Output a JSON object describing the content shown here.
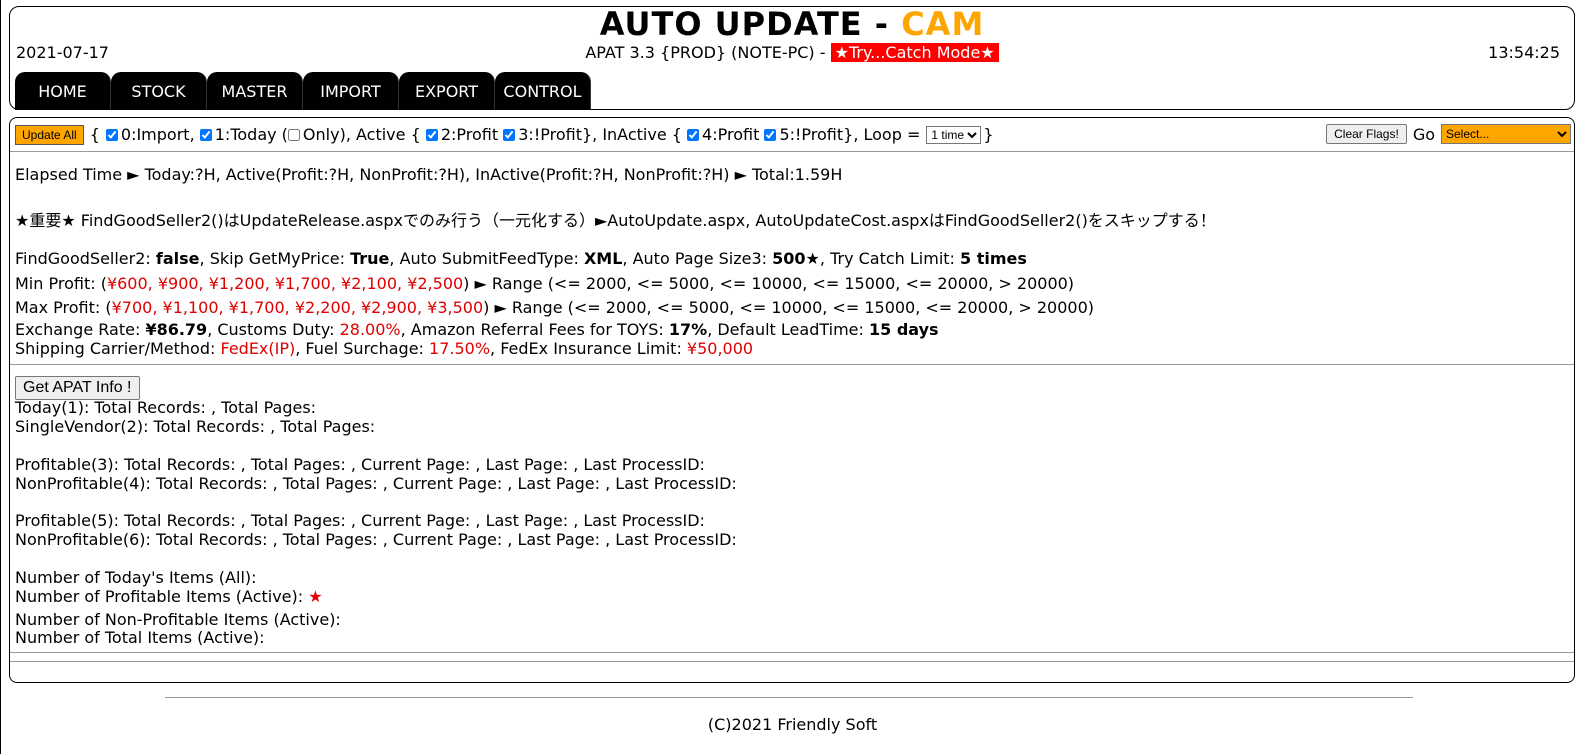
{
  "header": {
    "title_main": "AUTO UPDATE - ",
    "title_accent": "CAM",
    "date": "2021-07-17",
    "time": "13:54:25",
    "version": "APAT 3.3 {PROD} (NOTE-PC) - ",
    "mode": "★Try...Catch Mode★"
  },
  "nav": [
    "HOME",
    "STOCK",
    "MASTER",
    "IMPORT",
    "EXPORT",
    "CONTROL"
  ],
  "toolbar": {
    "update_all": "Update All",
    "open_brace": "{",
    "chk0": "0:Import,",
    "chk1": "1:Today (",
    "only": "Only), Active {",
    "chk2": "2:Profit",
    "chk3": "3:!Profit}, InActive {",
    "chk4": "4:Profit",
    "chk5": "5:!Profit}, Loop =",
    "loop_value": "1 time",
    "close_brace": "}",
    "clear_flags": "Clear Flags!",
    "go_label": "Go",
    "go_select": "Select..."
  },
  "info": {
    "elapsed": "Elapsed Time ► Today:?H, Active(Profit:?H, NonProfit:?H), InActive(Profit:?H, NonProfit:?H) ► Total:1.59H",
    "important": "★重要★ FindGoodSeller2()はUpdateRelease.aspxでのみ行う（一元化する）►AutoUpdate.aspx, AutoUpdateCost.aspxはFindGoodSeller2()をスキップする！",
    "fgs_label": "FindGoodSeller2: ",
    "fgs_value": "false",
    "skip_label": ", Skip GetMyPrice: ",
    "skip_value": "True",
    "feed_label": ", Auto SubmitFeedType: ",
    "feed_value": "XML",
    "page_label": ", Auto Page Size3: ",
    "page_value": "500★",
    "catch_label": ", Try Catch Limit: ",
    "catch_value": "5 times",
    "min_label": "Min Profit: (",
    "min_values": "¥600, ¥900, ¥1,200, ¥1,700, ¥2,100, ¥2,500",
    "min_range": ") ► Range (<= 2000, <= 5000, <= 10000, <= 15000, <= 20000, > 20000)",
    "max_label": "Max Profit: (",
    "max_values": "¥700, ¥1,100, ¥1,700, ¥2,200, ¥2,900, ¥3,500",
    "max_range": ") ► Range (<= 2000, <= 5000, <= 10000, <= 15000, <= 20000, > 20000)",
    "ex_label": "Exchange Rate: ",
    "ex_value": "¥86.79",
    "duty_label": ", Customs Duty: ",
    "duty_value": "28.00%",
    "fee_label": ", Amazon Referral Fees for TOYS: ",
    "fee_value": "17%",
    "lead_label": ", Default LeadTime: ",
    "lead_value": "15 days",
    "ship_label": "Shipping Carrier/Method: ",
    "ship_value": "FedEx(IP)",
    "fuel_label": ", Fuel Surchage: ",
    "fuel_value": "17.50%",
    "ins_label": ", FedEx Insurance Limit: ",
    "ins_value": "¥50,000"
  },
  "stats": {
    "get_info": "Get APAT Info !",
    "today": "Today(1): Total Records: , Total Pages:",
    "single": "SingleVendor(2): Total Records: , Total Pages:",
    "prof3": "Profitable(3): Total Records: , Total Pages: , Current Page: , Last Page: , Last ProcessID:",
    "nonprof4": "NonProfitable(4): Total Records: , Total Pages: , Current Page: , Last Page: , Last ProcessID:",
    "prof5": "Profitable(5): Total Records: , Total Pages: , Current Page: , Last Page: , Last ProcessID:",
    "nonprof6": "NonProfitable(6): Total Records: , Total Pages: , Current Page: , Last Page: , Last ProcessID:",
    "num_today": "Number of Today's Items (All):",
    "num_profitable": "Number of Profitable Items (Active): ",
    "star": "★",
    "num_nonprofitable": "Number of Non-Profitable Items (Active):",
    "num_total": "Number of Total Items (Active):"
  },
  "footer": "(C)2021 Friendly Soft"
}
